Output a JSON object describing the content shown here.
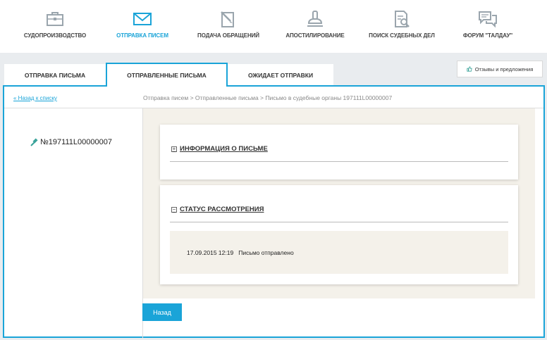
{
  "nav": {
    "items": [
      {
        "label": "СУДОПРОИЗВОДСТВО",
        "icon": "briefcase-icon",
        "active": false
      },
      {
        "label": "ОТПРАВКА ПИСЕМ",
        "icon": "envelope-icon",
        "active": true
      },
      {
        "label": "ПОДАЧА ОБРАЩЕНИЙ",
        "icon": "document-pen-icon",
        "active": false
      },
      {
        "label": "АПОСТИЛИРОВАНИЕ",
        "icon": "stamp-icon",
        "active": false
      },
      {
        "label": "ПОИСК СУДЕБНЫХ ДЕЛ",
        "icon": "document-search-icon",
        "active": false
      },
      {
        "label": "ФОРУМ \"ТАЛДАУ\"",
        "icon": "chat-bubbles-icon",
        "active": false
      }
    ]
  },
  "tabs": [
    {
      "label": "ОТПРАВКА ПИСЬМА",
      "active": false
    },
    {
      "label": "ОТПРАВЛЕННЫЕ ПИСЬМА",
      "active": true
    },
    {
      "label": "ОЖИДАЕТ ОТПРАВКИ",
      "active": false
    }
  ],
  "feedback": {
    "label": "Отзывы и предложения",
    "icon": "thumbs-up-icon"
  },
  "back_link": "« Назад к списку",
  "breadcrumb": "Отправка писем > Отправленные письма > Письмо в судебные органы 197111L00000007",
  "doc_number": "№197111L00000007",
  "sections": {
    "info_title": "ИНФОРМАЦИЯ О ПИСЬМЕ",
    "status_title": "СТАТУС РАССМОТРЕНИЯ"
  },
  "status_entry": {
    "date": "17.09.2015 12:19",
    "text": "Письмо отправлено"
  },
  "back_button": "Назад",
  "colors": {
    "accent": "#1aa4d8",
    "icon_gray": "#9aa5ad",
    "icon_teal": "#3aa39a"
  }
}
